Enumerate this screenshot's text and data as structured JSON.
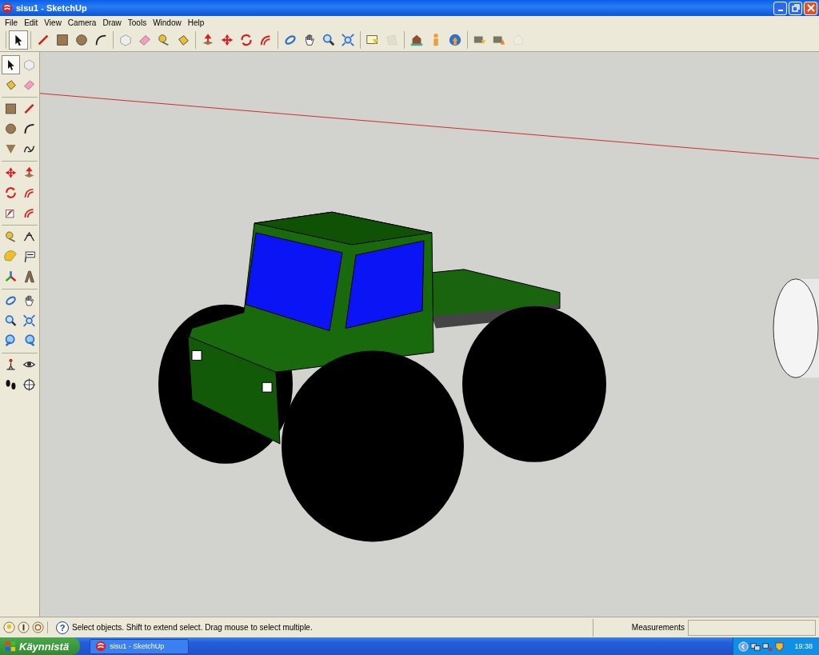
{
  "window": {
    "title": "sisu1 - SketchUp"
  },
  "menu": [
    "File",
    "Edit",
    "View",
    "Camera",
    "Draw",
    "Tools",
    "Window",
    "Help"
  ],
  "toolbar": {
    "groups": [
      {
        "tools": [
          {
            "kind": "select",
            "selected": true,
            "disabled": false
          }
        ]
      },
      {
        "tools": [
          {
            "kind": "pencil",
            "selected": false,
            "disabled": false
          },
          {
            "kind": "rectangle",
            "selected": false,
            "disabled": false
          },
          {
            "kind": "circle",
            "selected": false,
            "disabled": false
          },
          {
            "kind": "arc",
            "selected": false,
            "disabled": false
          }
        ]
      },
      {
        "tools": [
          {
            "kind": "component",
            "selected": false,
            "disabled": false
          },
          {
            "kind": "eraser",
            "selected": false,
            "disabled": false
          },
          {
            "kind": "tape",
            "selected": false,
            "disabled": false
          },
          {
            "kind": "paint",
            "selected": false,
            "disabled": false
          }
        ]
      },
      {
        "tools": [
          {
            "kind": "pushpull",
            "selected": false,
            "disabled": false
          },
          {
            "kind": "move",
            "selected": false,
            "disabled": false
          },
          {
            "kind": "rotate",
            "selected": false,
            "disabled": false
          },
          {
            "kind": "followme",
            "selected": false,
            "disabled": false
          }
        ]
      },
      {
        "tools": [
          {
            "kind": "orbit",
            "selected": false,
            "disabled": false
          },
          {
            "kind": "pan",
            "selected": false,
            "disabled": false
          },
          {
            "kind": "zoom",
            "selected": false,
            "disabled": false
          },
          {
            "kind": "zoomext",
            "selected": false,
            "disabled": false
          }
        ]
      },
      {
        "tools": [
          {
            "kind": "location",
            "selected": false,
            "disabled": false
          },
          {
            "kind": "terrain",
            "selected": false,
            "disabled": true
          }
        ]
      },
      {
        "tools": [
          {
            "kind": "photo",
            "selected": false,
            "disabled": false
          },
          {
            "kind": "building",
            "selected": false,
            "disabled": false
          },
          {
            "kind": "earth",
            "selected": false,
            "disabled": false
          }
        ]
      },
      {
        "tools": [
          {
            "kind": "getmodel",
            "selected": false,
            "disabled": false
          },
          {
            "kind": "sharemodel",
            "selected": false,
            "disabled": false
          },
          {
            "kind": "sharecomp",
            "selected": false,
            "disabled": true
          }
        ]
      }
    ]
  },
  "side_toolbar": {
    "groups": [
      {
        "tools": [
          {
            "kind": "select",
            "selected": true
          },
          {
            "kind": "component",
            "selected": false
          },
          {
            "kind": "paint",
            "selected": false
          },
          {
            "kind": "eraser",
            "selected": false
          }
        ]
      },
      {
        "tools": [
          {
            "kind": "rectangle",
            "selected": false
          },
          {
            "kind": "pencil",
            "selected": false
          },
          {
            "kind": "circle",
            "selected": false
          },
          {
            "kind": "arc",
            "selected": false
          },
          {
            "kind": "polygon",
            "selected": false
          },
          {
            "kind": "freehand",
            "selected": false
          }
        ]
      },
      {
        "tools": [
          {
            "kind": "move",
            "selected": false
          },
          {
            "kind": "pushpull",
            "selected": false
          },
          {
            "kind": "rotate",
            "selected": false
          },
          {
            "kind": "followme",
            "selected": false
          },
          {
            "kind": "scale",
            "selected": false
          },
          {
            "kind": "offset",
            "selected": false
          }
        ]
      },
      {
        "tools": [
          {
            "kind": "tape",
            "selected": false
          },
          {
            "kind": "dimension",
            "selected": false
          },
          {
            "kind": "protractor",
            "selected": false
          },
          {
            "kind": "text",
            "selected": false
          },
          {
            "kind": "axes",
            "selected": false
          },
          {
            "kind": "text3d",
            "selected": false
          }
        ]
      },
      {
        "tools": [
          {
            "kind": "orbit",
            "selected": false
          },
          {
            "kind": "pan",
            "selected": false
          },
          {
            "kind": "zoom",
            "selected": false
          },
          {
            "kind": "zoomext",
            "selected": false
          },
          {
            "kind": "previous",
            "selected": false
          },
          {
            "kind": "next",
            "selected": false
          }
        ]
      },
      {
        "tools": [
          {
            "kind": "walk",
            "selected": false
          },
          {
            "kind": "lookaround",
            "selected": false
          },
          {
            "kind": "footprints",
            "selected": false
          },
          {
            "kind": "section",
            "selected": false
          }
        ]
      }
    ]
  },
  "status_bar": {
    "help": "?",
    "message": "Select objects. Shift to extend select. Drag mouse to select multiple.",
    "measurements_label": "Measurements"
  },
  "taskbar": {
    "start": "Käynnistä",
    "task": "sisu1 - SketchUp",
    "clock": "19:38"
  }
}
